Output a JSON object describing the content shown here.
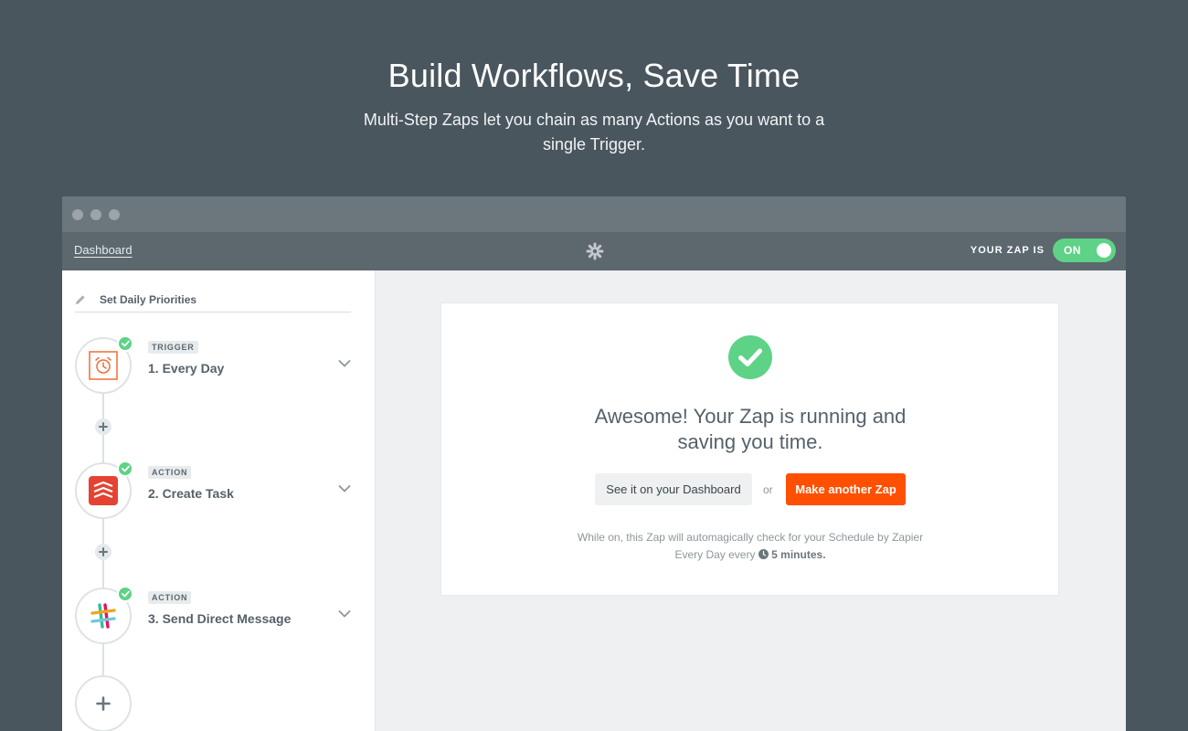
{
  "hero": {
    "title": "Build Workflows, Save Time",
    "subtitle": "Multi-Step Zaps let you chain as many Actions as you want to a single Trigger."
  },
  "appbar": {
    "dashboard_link": "Dashboard",
    "logo_icon": "zapier-asterisk-icon",
    "zap_status_label": "YOUR ZAP IS",
    "toggle_label": "ON",
    "toggle_on": true
  },
  "sidebar": {
    "zap_name": "Set Daily Priorities",
    "steps": [
      {
        "tag": "TRIGGER",
        "title": "1. Every Day",
        "icon": "alarm-clock-icon",
        "complete": true
      },
      {
        "tag": "ACTION",
        "title": "2. Create Task",
        "icon": "todoist-icon",
        "complete": true
      },
      {
        "tag": "ACTION",
        "title": "3. Send Direct Message",
        "icon": "slack-icon",
        "complete": true
      }
    ]
  },
  "card": {
    "heading": "Awesome! Your Zap is running and saving you time.",
    "dashboard_button": "See it on your Dashboard",
    "or_text": "or",
    "make_button": "Make another Zap",
    "note_prefix": "While on, this Zap will automagically check for your Schedule by Zapier Every Day every",
    "note_interval": "5 minutes."
  },
  "colors": {
    "background": "#4a565e",
    "success_green": "#5ed286",
    "accent_orange": "#ff4f00"
  }
}
